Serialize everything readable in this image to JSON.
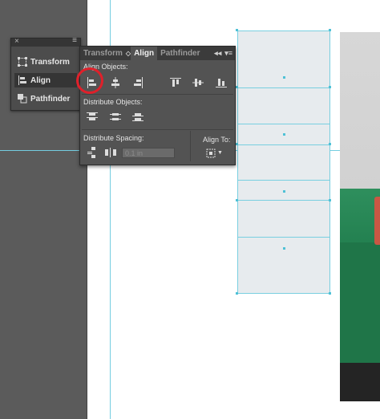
{
  "colors": {
    "guide": "#74cde0",
    "panel": "#535353",
    "tab_bar": "#3b3b3b",
    "highlight": "#e0202a",
    "frame_fill": "#e7ebee"
  },
  "dock": {
    "close_icon": "close-icon",
    "items": [
      {
        "label": "Transform",
        "icon": "transform-icon"
      },
      {
        "label": "Align",
        "icon": "align-icon"
      },
      {
        "label": "Pathfinder",
        "icon": "pathfinder-icon"
      }
    ]
  },
  "panel": {
    "tabs": [
      {
        "label": "Transform"
      },
      {
        "label": "Align"
      },
      {
        "label": "Pathfinder"
      }
    ],
    "tab_separator": "◇",
    "menu_icons": [
      "collapse-icon",
      "panel-menu-icon"
    ],
    "align_objects_label": "Align Objects:",
    "distribute_objects_label": "Distribute Objects:",
    "distribute_spacing_label": "Distribute Spacing:",
    "spacing_value": "0.1 in",
    "align_to_label": "Align To:"
  }
}
